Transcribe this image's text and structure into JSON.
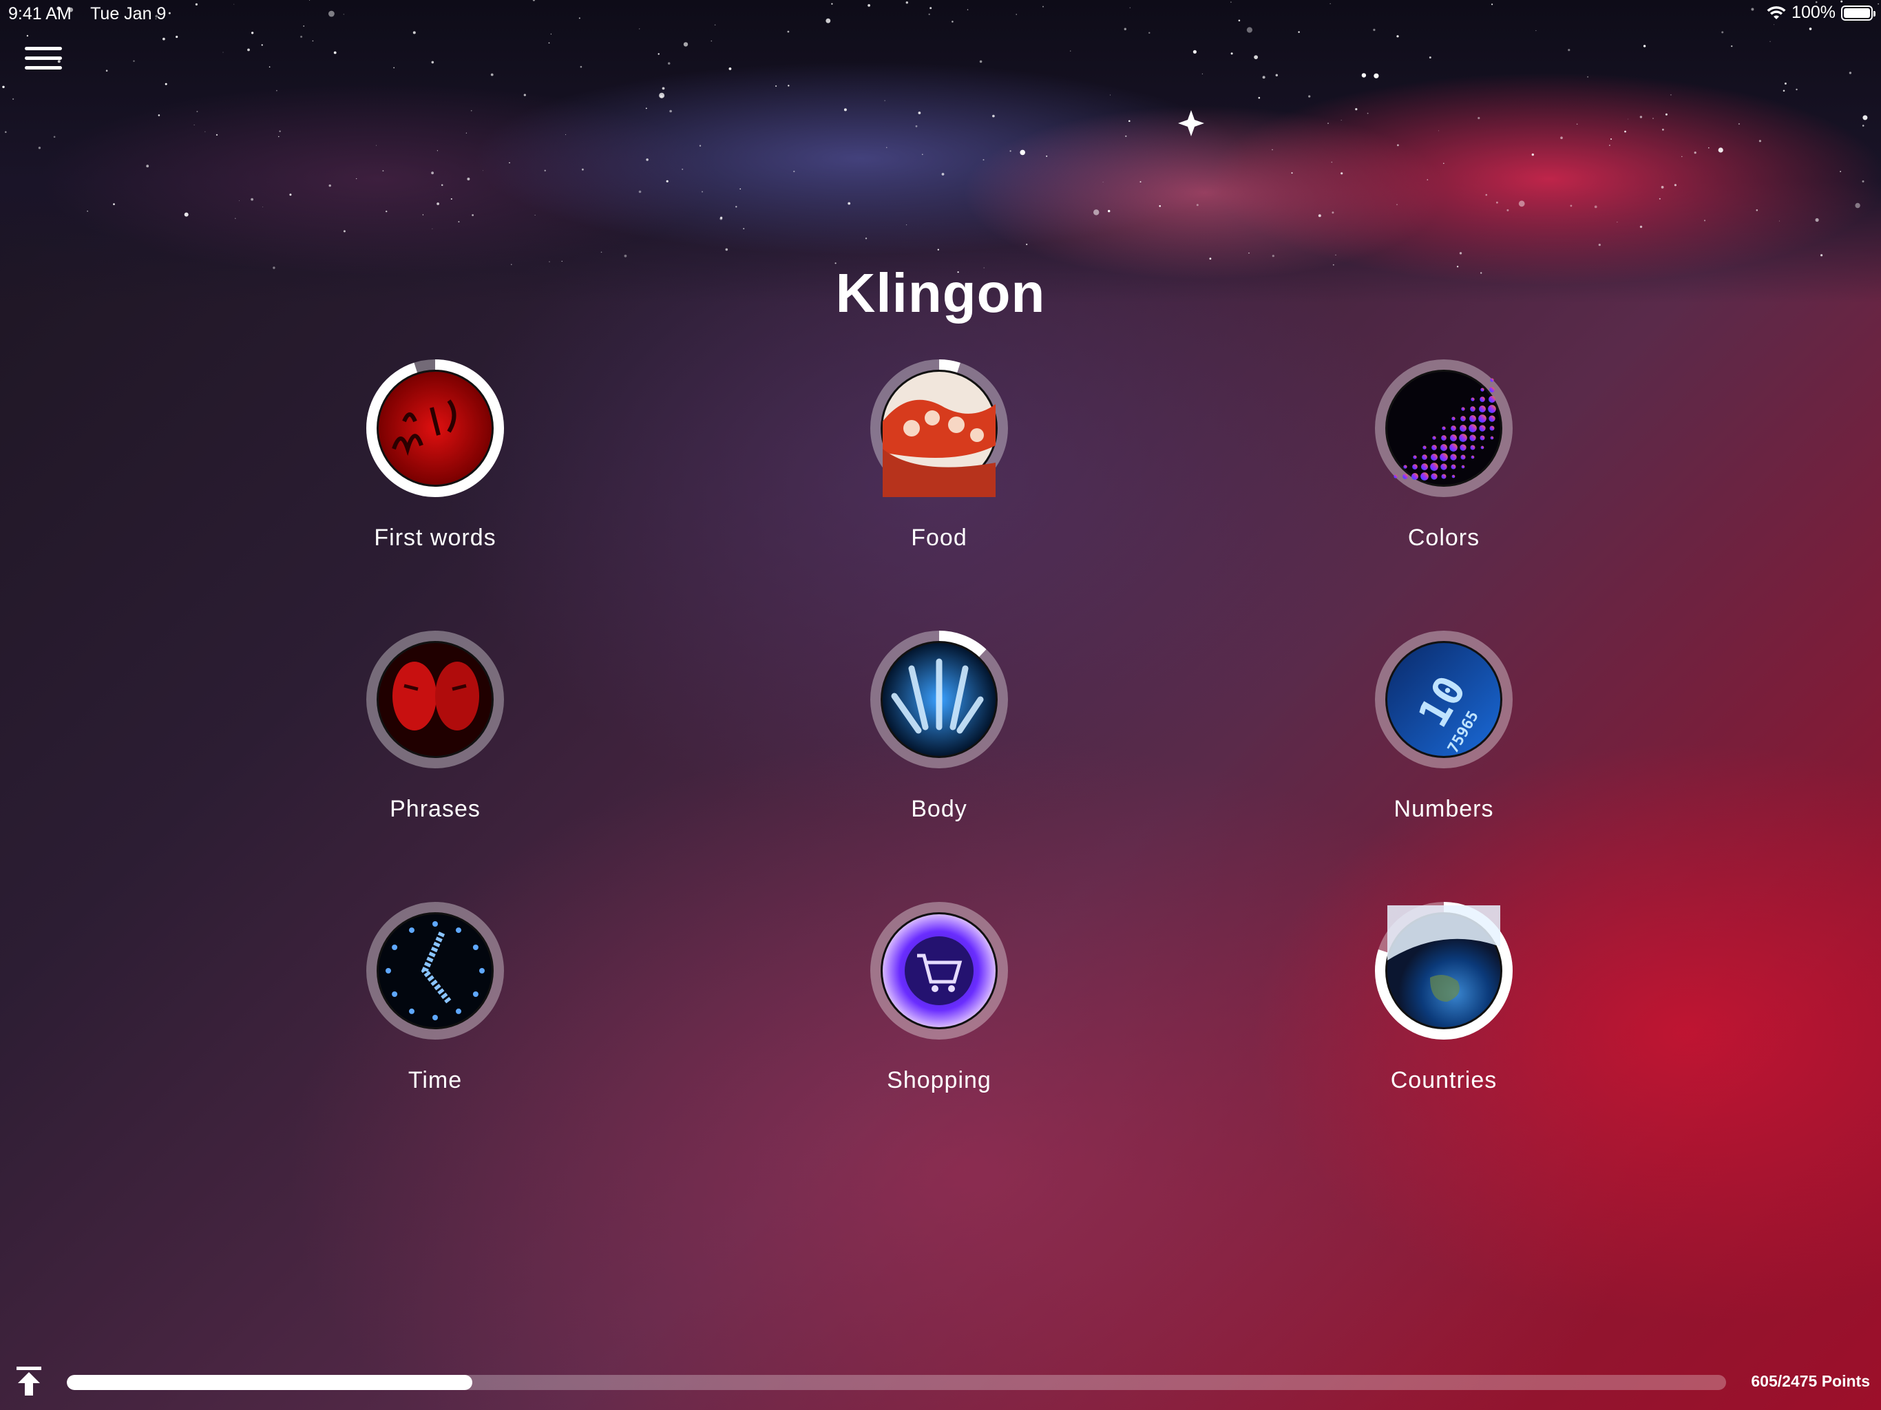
{
  "status_bar": {
    "time": "9:41 AM",
    "date": "Tue Jan 9",
    "battery": "100%"
  },
  "title": "Klingon",
  "categories": [
    {
      "label": "First words",
      "progress": 0.95,
      "icon": "red-script-icon"
    },
    {
      "label": "Food",
      "progress": 0.05,
      "icon": "octopus-food-icon"
    },
    {
      "label": "Colors",
      "progress": 0.0,
      "icon": "colorful-dots-icon"
    },
    {
      "label": "Phrases",
      "progress": 0.0,
      "icon": "faces-icon"
    },
    {
      "label": "Body",
      "progress": 0.12,
      "icon": "xray-hand-icon"
    },
    {
      "label": "Numbers",
      "progress": 0.0,
      "icon": "digital-numbers-icon"
    },
    {
      "label": "Time",
      "progress": 0.0,
      "icon": "clock-icon"
    },
    {
      "label": "Shopping",
      "progress": 0.0,
      "icon": "shopping-cart-icon"
    },
    {
      "label": "Countries",
      "progress": 0.8,
      "icon": "earth-icon"
    }
  ],
  "footer": {
    "points": "605/2475 Points",
    "points_earned": 605,
    "points_total": 2475
  }
}
